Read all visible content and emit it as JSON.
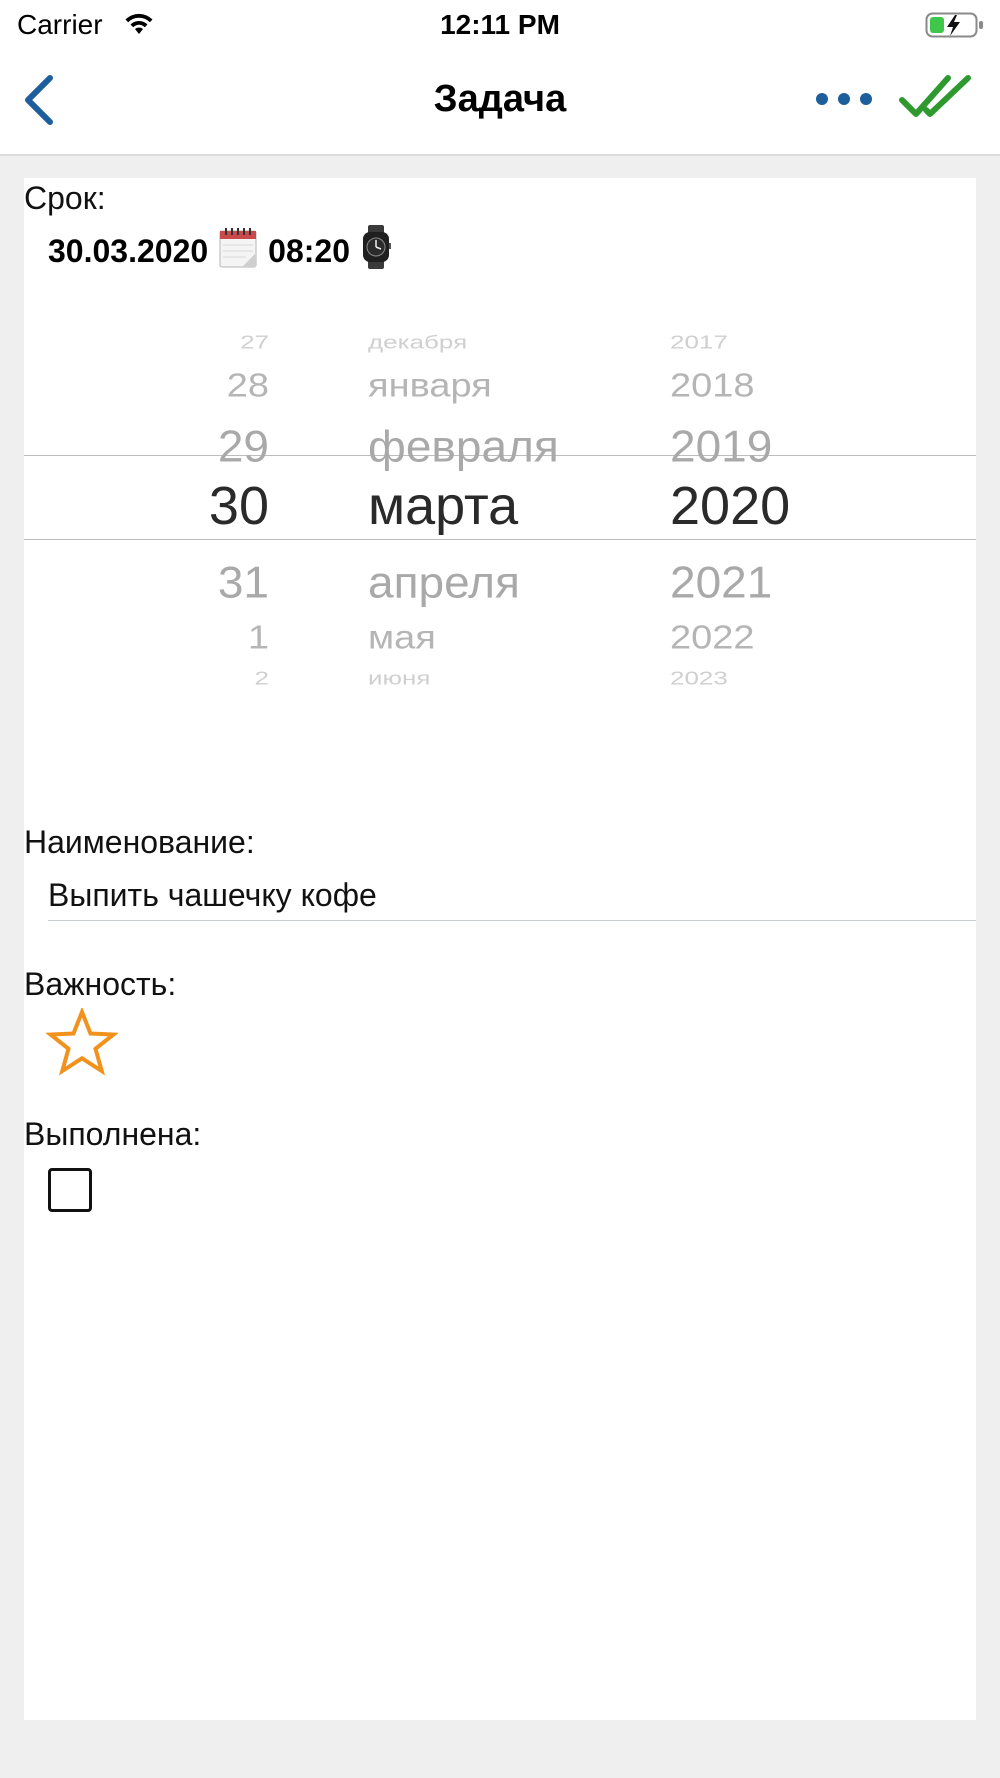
{
  "status_bar": {
    "carrier": "Carrier",
    "time": "12:11 PM",
    "wifi_icon": "wifi-icon",
    "battery_icon": "battery-charging-icon"
  },
  "nav": {
    "title": "Задача",
    "back_icon": "chevron-left-icon",
    "more_icon": "more-horizontal-icon",
    "done_icon": "double-check-icon",
    "accent_color": "#1d5f9c",
    "done_color": "#2e9a2e"
  },
  "form": {
    "deadline_label": "Срок:",
    "deadline_date": "30.03.2020",
    "deadline_time": "08:20",
    "calendar_icon": "calendar-icon",
    "watch_icon": "watch-icon",
    "name_label": "Наименование:",
    "name_value": "Выпить чашечку кофе",
    "importance_label": "Важность:",
    "importance_icon": "star-outline-icon",
    "importance_color": "#f0921c",
    "done_label": "Выполнена:",
    "done_checked": false
  },
  "picker": {
    "days": [
      "27",
      "28",
      "29",
      "30",
      "31",
      "1",
      "2"
    ],
    "months": [
      "декабря",
      "января",
      "февраля",
      "марта",
      "апреля",
      "мая",
      "июня"
    ],
    "years": [
      "2017",
      "2018",
      "2019",
      "2020",
      "2021",
      "2022",
      "2023"
    ],
    "selected": {
      "day": "30",
      "month": "марта",
      "year": "2020"
    }
  }
}
